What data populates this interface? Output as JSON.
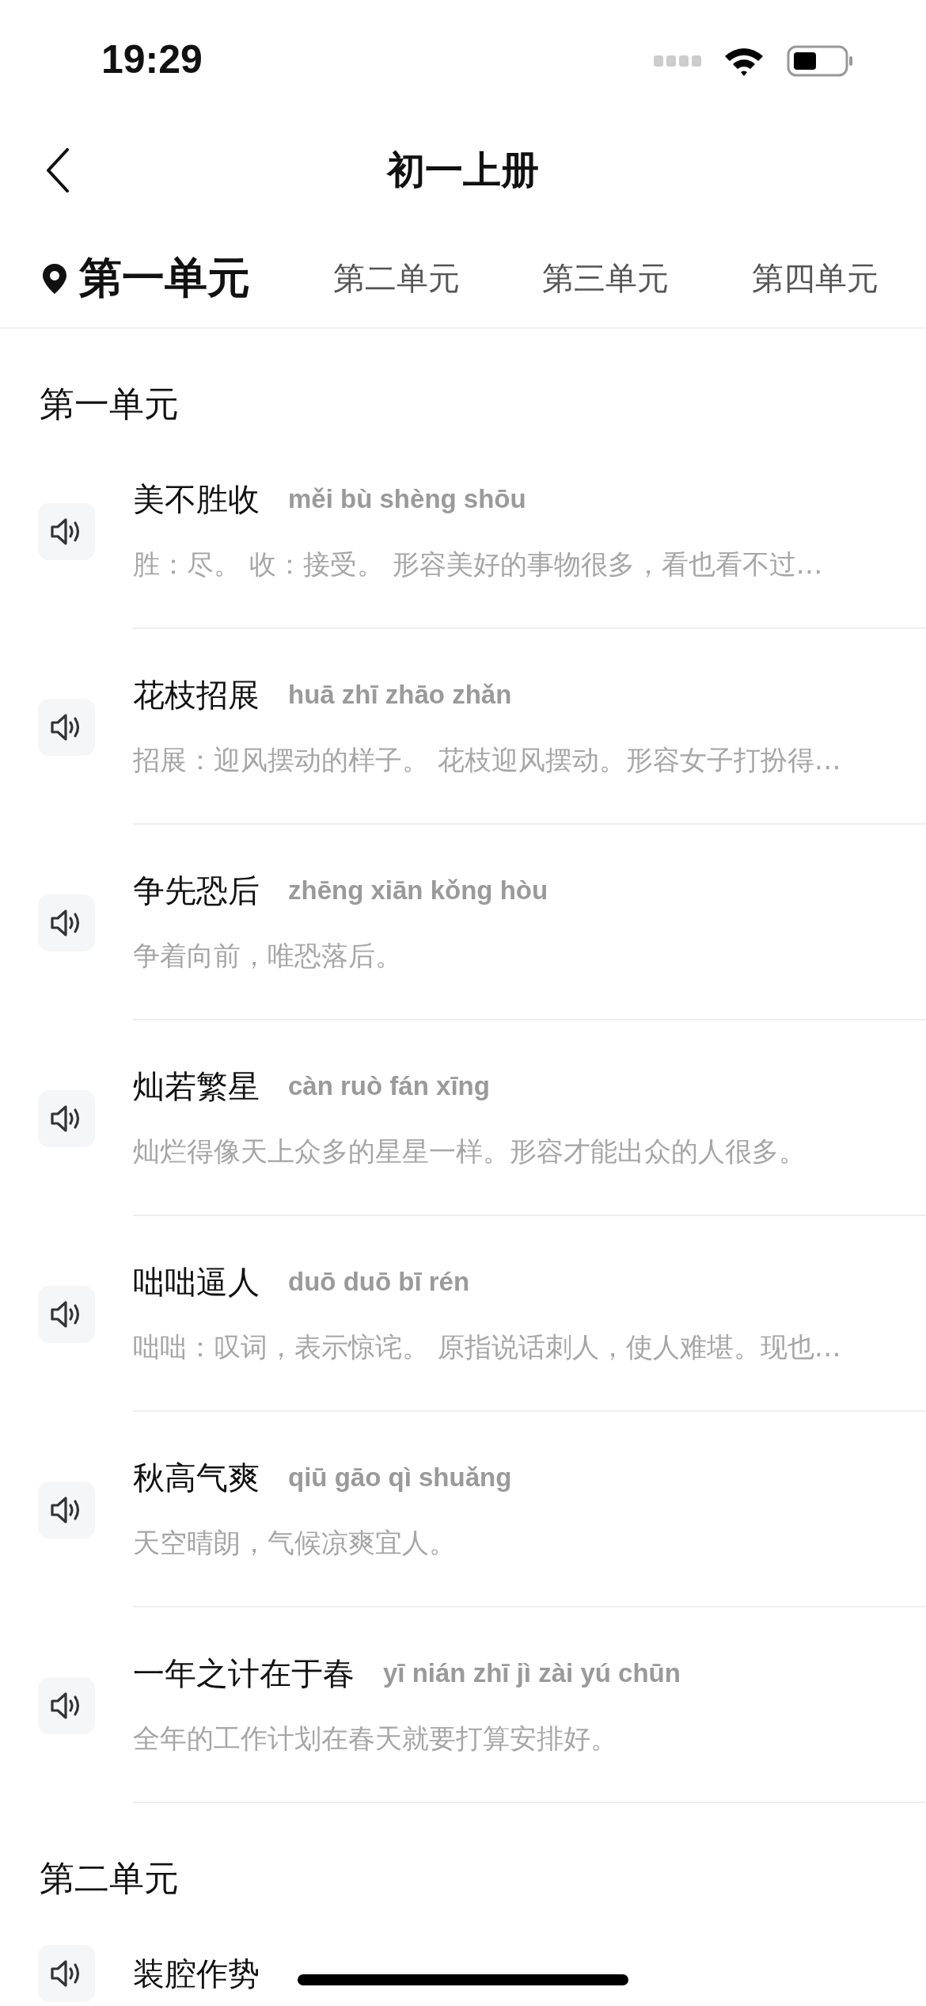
{
  "status_bar": {
    "time": "19:29"
  },
  "nav": {
    "title": "初一上册"
  },
  "tabs": [
    {
      "label": "第一单元",
      "selected": true
    },
    {
      "label": "第二单元",
      "selected": false
    },
    {
      "label": "第三单元",
      "selected": false
    },
    {
      "label": "第四单元",
      "selected": false
    }
  ],
  "sections": [
    {
      "title": "第一单元",
      "idioms": [
        {
          "word": "美不胜收",
          "pinyin": "měi bù shèng shōu",
          "meaning": "胜：尽。 收：接受。 形容美好的事物很多，看也看不过…"
        },
        {
          "word": "花枝招展",
          "pinyin": "huā zhī zhāo zhǎn",
          "meaning": "招展：迎风摆动的样子。 花枝迎风摆动。形容女子打扮得…"
        },
        {
          "word": "争先恐后",
          "pinyin": "zhēng xiān kǒng hòu",
          "meaning": "争着向前，唯恐落后。"
        },
        {
          "word": "灿若繁星",
          "pinyin": "càn ruò fán xīng",
          "meaning": "灿烂得像天上众多的星星一样。形容才能出众的人很多。"
        },
        {
          "word": "咄咄逼人",
          "pinyin": "duō duō bī rén",
          "meaning": "咄咄：叹词，表示惊诧。 原指说话刺人，使人难堪。现也…"
        },
        {
          "word": "秋高气爽",
          "pinyin": "qiū gāo qì shuǎng",
          "meaning": "天空晴朗，气候凉爽宜人。"
        },
        {
          "word": "一年之计在于春",
          "pinyin": "yī nián zhī jì zài yú chūn",
          "meaning": "全年的工作计划在春天就要打算安排好。"
        }
      ]
    },
    {
      "title": "第二单元",
      "idioms": [
        {
          "word": "装腔作势"
        }
      ]
    }
  ]
}
